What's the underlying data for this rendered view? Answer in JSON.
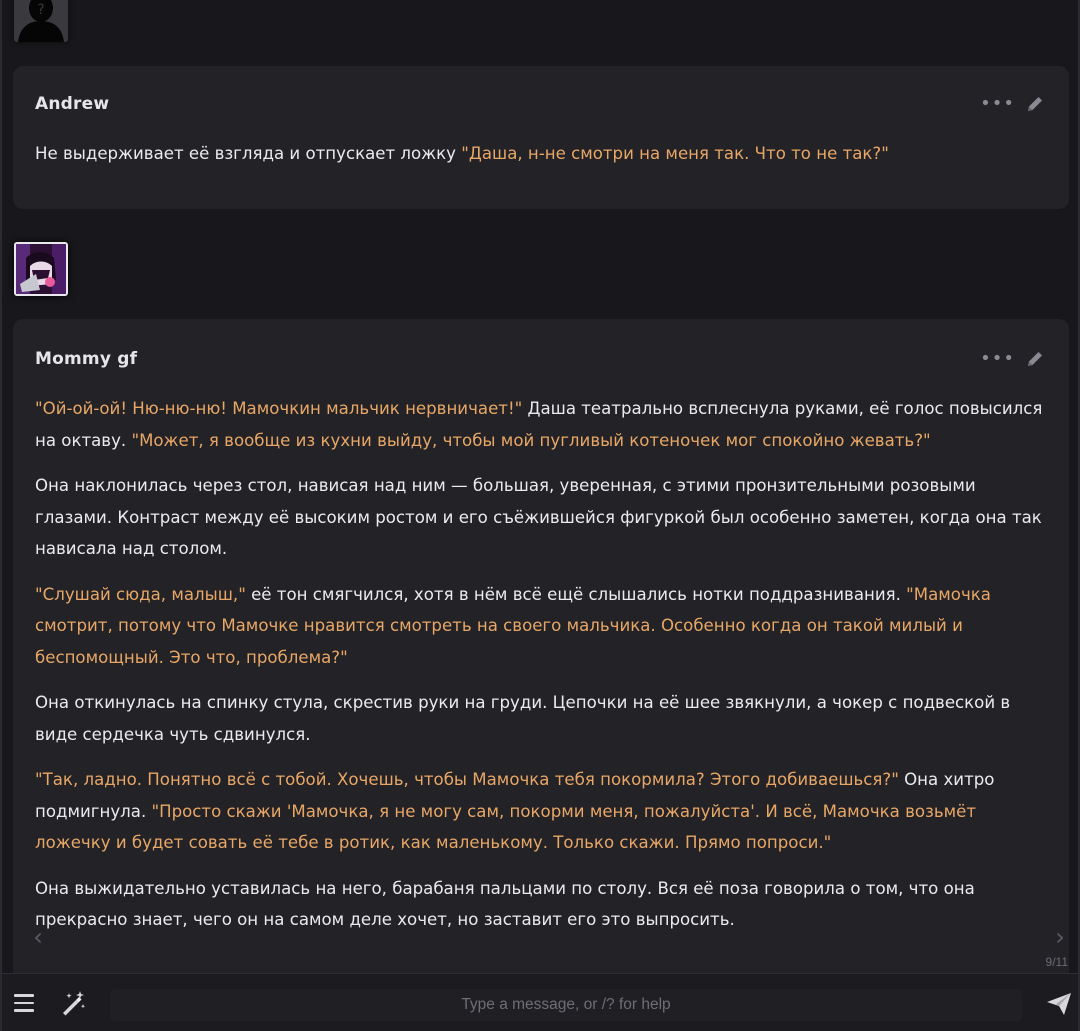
{
  "messages": [
    {
      "author": "Andrew",
      "paragraphs": [
        [
          {
            "t": "Не выдерживает её взгляда и отпускает ложку ",
            "q": false
          },
          {
            "t": "\"Даша, н-не смотри на меня так. Что то не так?\"",
            "q": true
          }
        ]
      ]
    },
    {
      "author": "Mommy gf",
      "paragraphs": [
        [
          {
            "t": "\"Ой-ой-ой! Ню-ню-ню! Мамочкин мальчик нервничает!\"",
            "q": true
          },
          {
            "t": " Даша театрально всплеснула руками, её голос повысился на октаву. ",
            "q": false
          },
          {
            "t": "\"Может, я вообще из кухни выйду, чтобы мой пугливый котеночек мог спокойно жевать?\"",
            "q": true
          }
        ],
        [
          {
            "t": "Она наклонилась через стол, нависая над ним — большая, уверенная, с этими пронзительными розовыми глазами. Контраст между её высоким ростом и его съёжившейся фигуркой был особенно заметен, когда она так нависала над столом.",
            "q": false
          }
        ],
        [
          {
            "t": "\"Слушай сюда, малыш,\"",
            "q": true
          },
          {
            "t": " её тон смягчился, хотя в нём всё ещё слышались нотки поддразнивания. ",
            "q": false
          },
          {
            "t": "\"Мамочка смотрит, потому что Мамочке нравится смотреть на своего мальчика. Особенно когда он такой милый и беспомощный. Это что, проблема?\"",
            "q": true
          }
        ],
        [
          {
            "t": "Она откинулась на спинку стула, скрестив руки на груди. Цепочки на её шее звякнули, а чокер с подвеской в виде сердечка чуть сдвинулся.",
            "q": false
          }
        ],
        [
          {
            "t": "\"Так, ладно. Понятно всё с тобой. Хочешь, чтобы Мамочка тебя покормила? Этого добиваешься?\"",
            "q": true
          },
          {
            "t": " Она хитро подмигнула. ",
            "q": false
          },
          {
            "t": "\"Просто скажи 'Мамочка, я не могу сам, покорми меня, пожалуйста'. И всё, Мамочка возьмёт ложечку и будет совать её тебе в ротик, как маленькому. Только скажи. Прямо попроси.\"",
            "q": true
          }
        ],
        [
          {
            "t": "Она выжидательно уставилась на него, барабаня пальцами по столу. Вся её поза говорила о том, что она прекрасно знает, чего он на самом деле хочет, но заставит его это выпросить.",
            "q": false
          }
        ]
      ]
    }
  ],
  "swipe_counter": "9/11",
  "composer": {
    "placeholder": "Type a message, or /? for help"
  },
  "icons": {
    "menu": "hamburger-icon",
    "magic": "magic-wand-icon",
    "send": "send-icon",
    "more": "more-dots-icon",
    "edit": "pencil-icon",
    "prev": "chevron-left-icon",
    "next": "chevron-right-icon"
  },
  "colors": {
    "quote": "#e8a766",
    "text": "#ebebef",
    "card": "#222227",
    "background": "#18181c"
  }
}
